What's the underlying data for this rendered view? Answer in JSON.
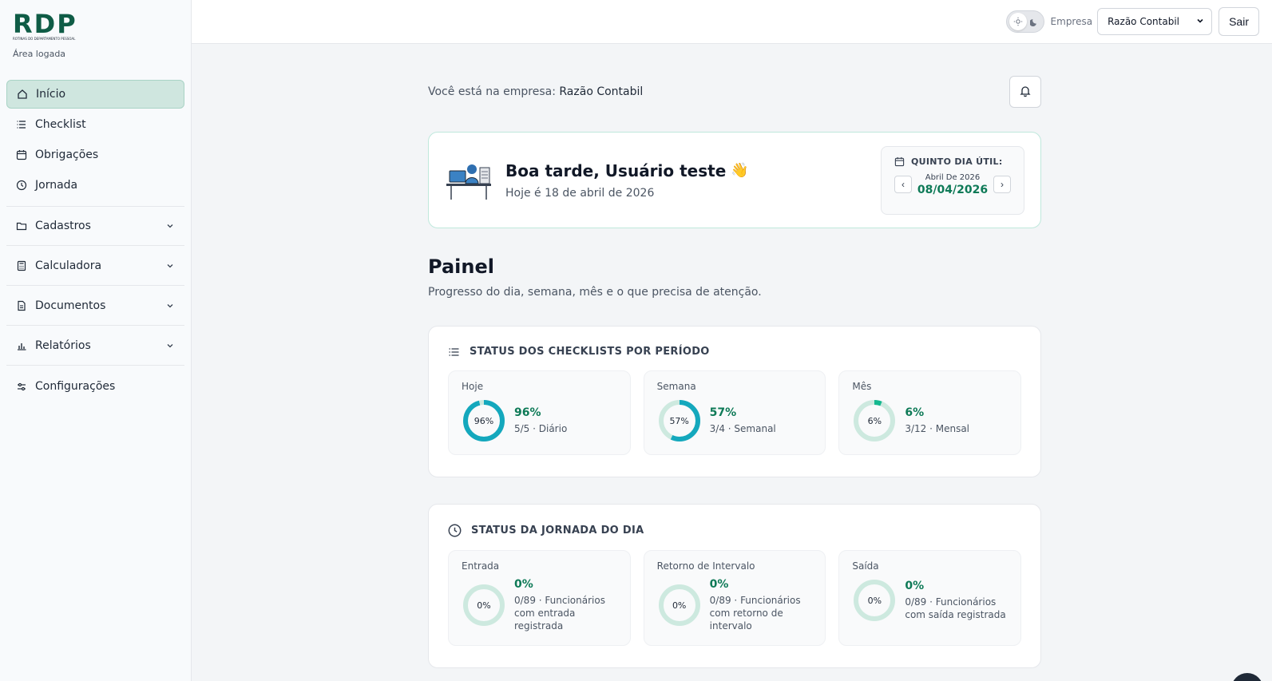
{
  "brand": {
    "logo_text": "RDP",
    "logo_subtitle": "ROTINAS DO DEPARTAMENTO PESSOAL",
    "area_label": "Área logada"
  },
  "sidebar": {
    "items": [
      {
        "label": "Início",
        "icon": "home-icon",
        "active": true
      },
      {
        "label": "Checklist",
        "icon": "list-icon"
      },
      {
        "label": "Obrigações",
        "icon": "calendar-icon"
      },
      {
        "label": "Jornada",
        "icon": "clock-icon"
      }
    ],
    "groups": [
      {
        "label": "Cadastros",
        "icon": "folder-icon"
      },
      {
        "label": "Calculadora",
        "icon": "calculator-icon"
      },
      {
        "label": "Documentos",
        "icon": "document-icon"
      },
      {
        "label": "Relatórios",
        "icon": "bar-chart-icon"
      }
    ],
    "settings": {
      "label": "Configurações",
      "icon": "sliders-icon"
    }
  },
  "topbar": {
    "company_label": "Empresa",
    "company_value": "Razão Contabil",
    "logout_label": "Sair"
  },
  "main": {
    "company_prefix": "Você está na empresa:",
    "company_name": "Razão Contabil",
    "greeting": {
      "title": "Boa tarde, Usuário teste",
      "emoji": "👋",
      "date_text": "Hoje é 18 de abril de 2026",
      "fifth_label": "QUINTO DIA ÚTIL:",
      "fifth_month": "Abril De 2026",
      "fifth_date": "08/04/2026",
      "prev": "‹",
      "next": "›"
    },
    "painel": {
      "title": "Painel",
      "subtitle": "Progresso do dia, semana, mês e o que precisa de atenção."
    },
    "checklists": {
      "title": "STATUS DOS CHECKLISTS POR PERÍODO",
      "tiles": [
        {
          "label": "Hoje",
          "ring_text": "96%",
          "percent": 96,
          "pct": "96%",
          "desc": "5/5 · Diário",
          "color": "#14a8bd"
        },
        {
          "label": "Semana",
          "ring_text": "57%",
          "percent": 57,
          "pct": "57%",
          "desc": "3/4 · Semanal",
          "color": "#14a8bd"
        },
        {
          "label": "Mês",
          "ring_text": "6%",
          "percent": 6,
          "pct": "6%",
          "desc": "3/12 · Mensal",
          "color": "#14b88f"
        }
      ]
    },
    "jornada": {
      "title": "STATUS DA JORNADA DO DIA",
      "tiles": [
        {
          "label": "Entrada",
          "ring_text": "0%",
          "percent": 0,
          "pct": "0%",
          "desc": "0/89 · Funcionários com entrada registrada"
        },
        {
          "label": "Retorno de Intervalo",
          "ring_text": "0%",
          "percent": 0,
          "pct": "0%",
          "desc": "0/89 · Funcionários com retorno de intervalo"
        },
        {
          "label": "Saída",
          "ring_text": "0%",
          "percent": 0,
          "pct": "0%",
          "desc": "0/89 · Funcionários com saída registrada"
        }
      ]
    }
  },
  "colors": {
    "accent": "#0e7a57",
    "ring_track": "#cde9df",
    "active_nav": "#cfe6df"
  }
}
